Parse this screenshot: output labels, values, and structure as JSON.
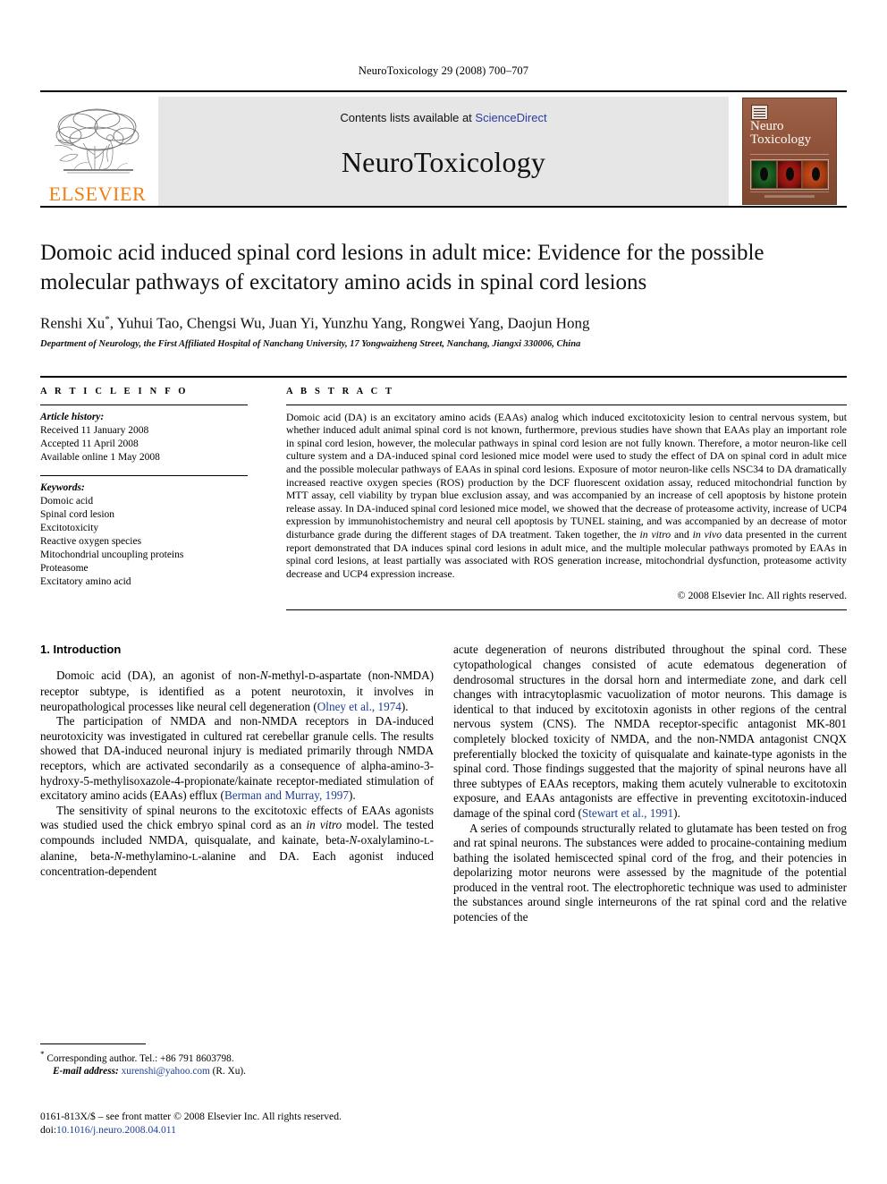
{
  "running_head": "NeuroToxicology 29 (2008) 700–707",
  "masthead": {
    "publisher_word": "ELSEVIER",
    "contents_prefix": "Contents lists available at ",
    "contents_link": "ScienceDirect",
    "journal_name": "NeuroToxicology",
    "cover_title_line1": "Neuro",
    "cover_title_line2": "Toxicology"
  },
  "article": {
    "title": "Domoic acid induced spinal cord lesions in adult mice: Evidence for the possible molecular pathways of excitatory amino acids in spinal cord lesions",
    "authors": "Renshi Xu",
    "authors_rest": ", Yuhui Tao, Chengsi Wu, Juan Yi, Yunzhu Yang, Rongwei Yang, Daojun Hong",
    "corresponding_marker": "*",
    "affiliation": "Department of Neurology, the First Affiliated Hospital of Nanchang University, 17 Yongwaizheng Street, Nanchang, Jiangxi 330006, China"
  },
  "article_info": {
    "heading": "A R T I C L E  I N F O",
    "history_label": "Article history:",
    "received": "Received 11 January 2008",
    "accepted": "Accepted 11 April 2008",
    "available": "Available online 1 May 2008",
    "keywords_label": "Keywords:",
    "keywords": [
      "Domoic acid",
      "Spinal cord lesion",
      "Excitotoxicity",
      "Reactive oxygen species",
      "Mitochondrial uncoupling proteins",
      "Proteasome",
      "Excitatory amino acid"
    ]
  },
  "abstract": {
    "heading": "A B S T R A C T",
    "part1": "Domoic acid (DA) is an excitatory amino acids (EAAs) analog which induced excitotoxicity lesion to central nervous system, but whether induced adult animal spinal cord is not known, furthermore, previous studies have shown that EAAs play an important role in spinal cord lesion, however, the molecular pathways in spinal cord lesion are not fully known. Therefore, a motor neuron-like cell culture system and a DA-induced spinal cord lesioned mice model were used to study the effect of DA on spinal cord in adult mice and the possible molecular pathways of EAAs in spinal cord lesions. Exposure of motor neuron-like cells NSC34 to DA dramatically increased reactive oxygen species (ROS) production by the DCF fluorescent oxidation assay, reduced mitochondrial function by MTT assay, cell viability by trypan blue exclusion assay, and was accompanied by an increase of cell apoptosis by histone protein release assay. In DA-induced spinal cord lesioned mice model, we showed that the decrease of proteasome activity, increase of UCP4 expression by immunohistochemistry and neural cell apoptosis by TUNEL staining, and was accompanied by an decrease of motor disturbance grade during the different stages of DA treatment. Taken together, the ",
    "italic1": "in vitro",
    "part2": " and ",
    "italic2": "in vivo",
    "part3": " data presented in the current report demonstrated that DA induces spinal cord lesions in adult mice, and the multiple molecular pathways promoted by EAAs in spinal cord lesions, at least partially was associated with ROS generation increase, mitochondrial dysfunction, proteasome activity decrease and UCP4 expression increase.",
    "copyright": "© 2008 Elsevier Inc. All rights reserved."
  },
  "introduction": {
    "heading": "1. Introduction",
    "left_paragraphs": [
      {
        "pre": "Domoic acid (DA), an agonist of non-",
        "it1": "N",
        "mid1": "-methyl-",
        "sc1": "D",
        "mid2": "-aspartate (non-NMDA) receptor subtype, is identified as a potent neurotoxin, it involves in neuropathological processes like neural cell degeneration (",
        "cite": "Olney et al., 1974",
        "post": ")."
      },
      {
        "pre": "The participation of NMDA and non-NMDA receptors in DA-induced neurotoxicity was investigated in cultured rat cerebellar granule cells. The results showed that DA-induced neuronal injury is mediated primarily through NMDA receptors, which are activated secondarily as a consequence of alpha-amino-3-hydroxy-5-methylisoxazole-4-propionate/kainate receptor-mediated stimulation of excitatory amino acids (EAAs) efflux (",
        "cite": "Berman and Murray, 1997",
        "post": ")."
      },
      {
        "pre": "The sensitivity of spinal neurons to the excitotoxic effects of EAAs agonists was studied used the chick embryo spinal cord as an ",
        "it1": "in vitro",
        "mid1": " model. The tested compounds included NMDA, quisqualate, and kainate, beta-",
        "it2": "N",
        "mid2": "-oxalylamino-",
        "sc1": "L",
        "mid3": "-alanine, beta-",
        "it3": "N",
        "mid4": "-methylamino-",
        "sc2": "L",
        "mid5": "-alanine and DA. Each agonist induced concentration-dependent"
      }
    ],
    "right_paragraphs": [
      {
        "pre": "acute degeneration of neurons distributed throughout the spinal cord. These cytopathological changes consisted of acute edematous degeneration of dendrosomal structures in the dorsal horn and intermediate zone, and dark cell changes with intracytoplasmic vacuolization of motor neurons. This damage is identical to that induced by excitotoxin agonists in other regions of the central nervous system (CNS). The NMDA receptor-specific antagonist MK-801 completely blocked toxicity of NMDA, and the non-NMDA antagonist CNQX preferentially blocked the toxicity of quisqualate and kainate-type agonists in the spinal cord. Those findings suggested that the majority of spinal neurons have all three subtypes of EAAs receptors, making them acutely vulnerable to excitotoxin exposure, and EAAs antagonists are effective in preventing excitotoxin-induced damage of the spinal cord (",
        "cite": "Stewart et al., 1991",
        "post": ")."
      },
      {
        "pre": "A series of compounds structurally related to glutamate has been tested on frog and rat spinal neurons. The substances were added to procaine-containing medium bathing the isolated hemiscected spinal cord of the frog, and their potencies in depolarizing motor neurons were assessed by the magnitude of the potential produced in the ventral root. The electrophoretic technique was used to administer the substances around single interneurons of the rat spinal cord and the relative potencies of the"
      }
    ]
  },
  "footnotes": {
    "corresponding": "Corresponding author. Tel.: +86 791 8603798.",
    "email_label": "E-mail address:",
    "email": "xurenshi@yahoo.com",
    "email_suffix": " (R. Xu).",
    "imprint": "0161-813X/$ – see front matter © 2008 Elsevier Inc. All rights reserved.",
    "doi_label": "doi:",
    "doi": "10.1016/j.neuro.2008.04.011"
  }
}
